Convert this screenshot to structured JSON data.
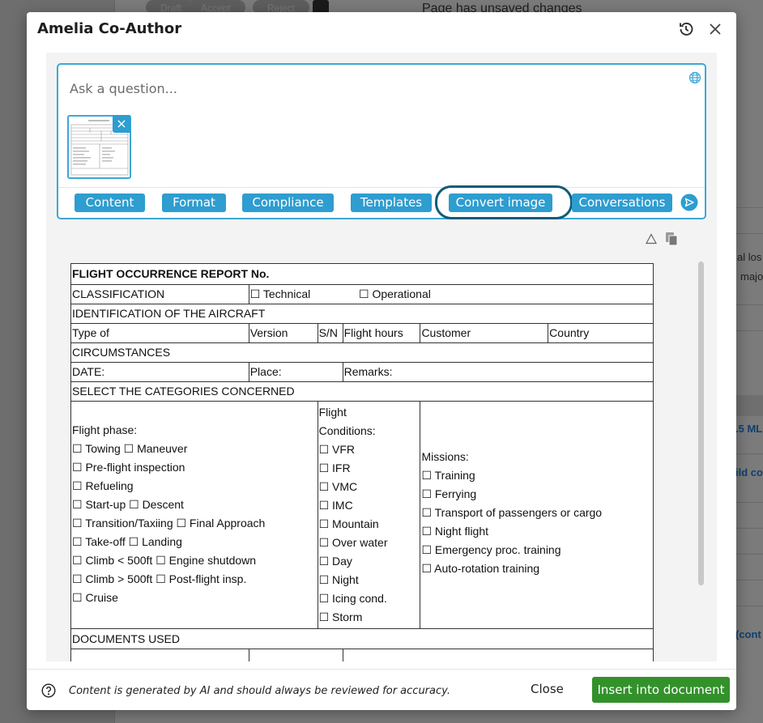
{
  "background": {
    "pills": [
      "Draft",
      "Accept",
      "Reject"
    ],
    "status_text": "Page has unsaved changes",
    "right_snippets": [
      "al los",
      "majo",
      ".5 ML",
      "ild co",
      "(cont"
    ]
  },
  "modal": {
    "title": "Amelia Co-Author",
    "history_icon": "history-icon",
    "close_icon": "close-icon"
  },
  "ask": {
    "placeholder": "Ask a question...",
    "globe_icon": "globe-icon",
    "attachment_remove": "×",
    "toolbar": [
      "Content",
      "Format",
      "Compliance",
      "Templates",
      "Convert image",
      "Conversations"
    ],
    "send_icon": "send-icon"
  },
  "doc_tools": [
    "warning-icon",
    "copy-icon"
  ],
  "form": {
    "title": "FLIGHT OCCURRENCE REPORT No.",
    "classification_label": "CLASSIFICATION",
    "classification_opt1": "☐ Technical",
    "classification_opt2": "☐ Operational",
    "aircraft_heading": "IDENTIFICATION OF THE AIRCRAFT",
    "aircraft_cols": [
      "Type of",
      "Version",
      "S/N",
      "Flight hours",
      "Customer",
      "Country"
    ],
    "circumstances": "CIRCUMSTANCES",
    "date_label": "DATE:",
    "place_label": "Place:",
    "remarks_label": "Remarks:",
    "categories_heading": "SELECT THE CATEGORIES CONCERNED",
    "flight_phase_label": "Flight phase:",
    "flight_phase": [
      "☐ Towing ☐ Maneuver",
      "☐ Pre-flight inspection",
      "☐ Refueling",
      "☐ Start-up ☐ Descent",
      "☐ Transition/Taxiing ☐ Final Approach",
      "☐ Take-off ☐ Landing",
      "☐ Climb < 500ft ☐ Engine shutdown",
      "☐ Climb > 500ft ☐ Post-flight insp.",
      "☐ Cruise"
    ],
    "flight_conditions_label_1": "Flight",
    "flight_conditions_label_2": "Conditions:",
    "flight_conditions": [
      "☐ VFR",
      "☐ IFR",
      "☐ VMC",
      "☐ IMC",
      "☐ Mountain",
      "☐ Over water",
      "☐ Day",
      "☐ Night",
      "☐ Icing cond.",
      "☐ Storm"
    ],
    "missions_label": "Missions:",
    "missions": [
      "☐ Training",
      "☐ Ferrying",
      "☐ Transport of passengers or cargo",
      "☐ Night flight",
      "☐ Emergency proc. training",
      "☐ Auto-rotation training"
    ],
    "documents_used": "DOCUMENTS USED"
  },
  "footer": {
    "help_icon": "help-icon",
    "disclaimer": "Content is generated by AI and should always be reviewed for accuracy.",
    "close_label": "Close",
    "insert_label": "Insert into document"
  },
  "colors": {
    "accent": "#2e9dd0",
    "accent_border": "#3ea7d6",
    "focus_ring": "#0f5b7a",
    "primary_green": "#33912b"
  }
}
